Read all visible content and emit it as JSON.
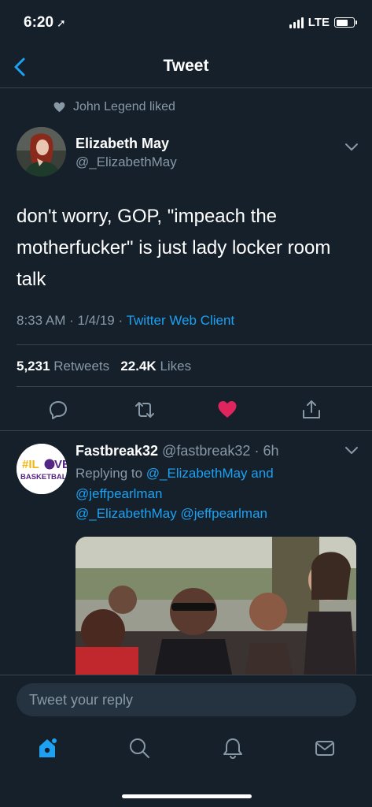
{
  "status_bar": {
    "time": "6:20",
    "network": "LTE"
  },
  "header": {
    "title": "Tweet"
  },
  "social_context": {
    "text": "John Legend liked"
  },
  "tweet": {
    "author_name": "Elizabeth May",
    "author_handle": "@_ElizabethMay",
    "text": "don't worry, GOP, \"impeach the motherfucker\" is just lady locker room talk",
    "time": "8:33 AM",
    "date": "1/4/19",
    "client": "Twitter Web Client",
    "retweets": "5,231",
    "retweets_label": "Retweets",
    "likes": "22.4K",
    "likes_label": "Likes",
    "liked": true
  },
  "reply": {
    "author_name": "Fastbreak32",
    "author_handle": "@fastbreak32",
    "age": "6h",
    "replying_prefix": "Replying to",
    "replying_user1": "@_ElizabethMay",
    "replying_and": "and",
    "replying_user2": "@jeffpearlman",
    "text": "@_ElizabethMay @jeffpearlman",
    "avatar_line1": "#IL",
    "avatar_line1b": "VE",
    "avatar_line2": "BASKETBALL"
  },
  "composer": {
    "placeholder": "Tweet your reply"
  },
  "colors": {
    "background": "#15202b",
    "accent": "#1da1f2",
    "like": "#e0245e",
    "muted": "#8899a6"
  },
  "tabs": [
    "home-icon",
    "search-icon",
    "notifications-icon",
    "messages-icon"
  ]
}
